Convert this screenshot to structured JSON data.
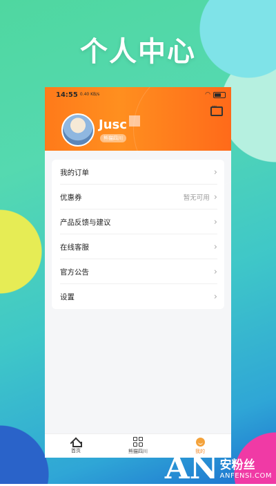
{
  "headline": "个人中心",
  "status_bar": {
    "time": "14:55",
    "speed": "0.40 KB/s"
  },
  "profile": {
    "username": "Jusc",
    "tag": "熊猫四川"
  },
  "menu": [
    {
      "label": "我的订单",
      "value": ""
    },
    {
      "label": "优惠券",
      "value": "暂无可用"
    },
    {
      "label": "产品反馈与建议",
      "value": ""
    },
    {
      "label": "在线客服",
      "value": ""
    },
    {
      "label": "官方公告",
      "value": ""
    },
    {
      "label": "设置",
      "value": ""
    }
  ],
  "tabs": [
    {
      "label": "首页",
      "icon": "home-icon"
    },
    {
      "label": "熊猫四川",
      "icon": "grid-icon"
    },
    {
      "label": "我的",
      "icon": "smile-icon",
      "active": true
    }
  ],
  "watermark": {
    "letters": "AN",
    "cn": "安粉丝",
    "en": "ANFENSI.COM"
  },
  "colors": {
    "header_orange": "#ff7a1a",
    "active_tab": "#f08a2a"
  }
}
